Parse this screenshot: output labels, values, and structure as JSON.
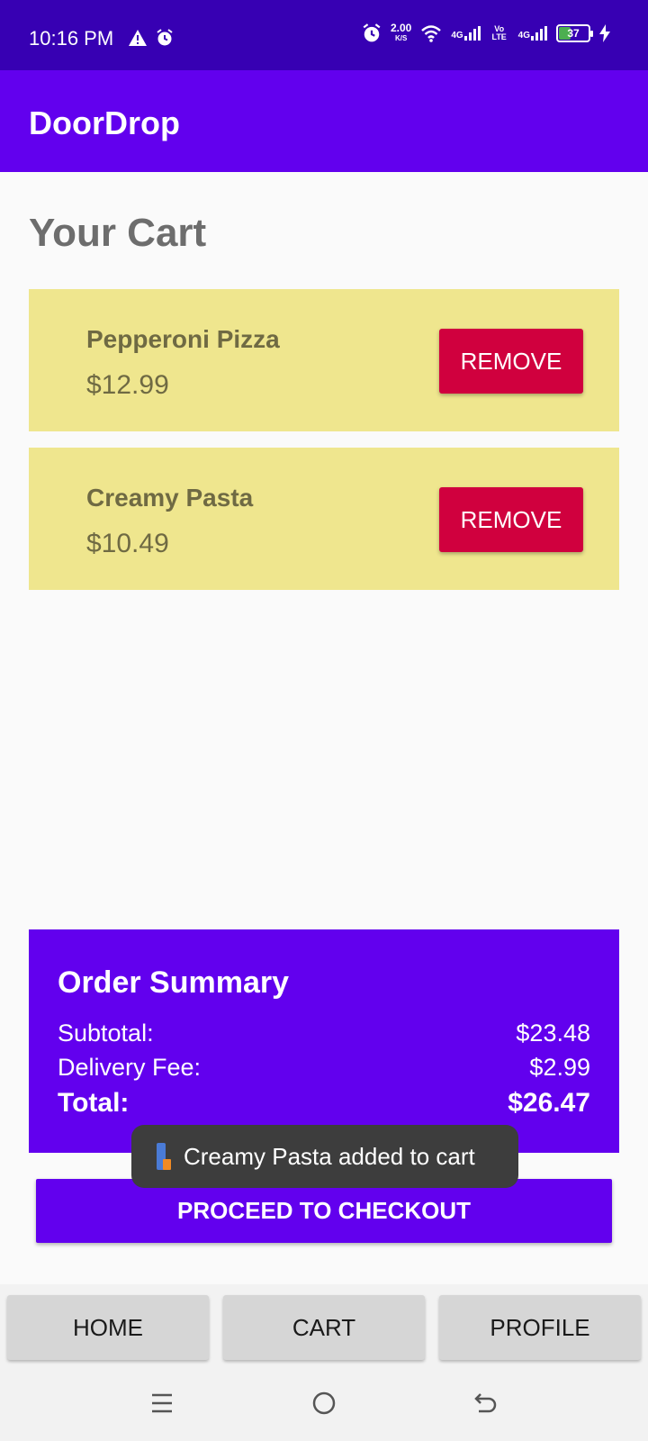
{
  "status_bar": {
    "time": "10:16 PM",
    "net_speed_value": "2.00",
    "net_speed_unit": "K/S",
    "sim1_label": "4G",
    "volte_label": "Vo LTE",
    "sim2_label": "4G",
    "battery_level": "37"
  },
  "app_bar": {
    "title": "DoorDrop"
  },
  "page": {
    "title": "Your Cart"
  },
  "cart_items": [
    {
      "name": "Pepperoni Pizza",
      "price": "$12.99",
      "remove_label": "REMOVE"
    },
    {
      "name": "Creamy Pasta",
      "price": "$10.49",
      "remove_label": "REMOVE"
    }
  ],
  "summary": {
    "title": "Order Summary",
    "subtotal_label": "Subtotal:",
    "subtotal_value": "$23.48",
    "delivery_label": "Delivery Fee:",
    "delivery_value": "$2.99",
    "total_label": "Total:",
    "total_value": "$26.47"
  },
  "toast": {
    "message": "Creamy Pasta added to cart"
  },
  "checkout": {
    "label": "PROCEED TO CHECKOUT"
  },
  "bottom_nav": [
    {
      "label": "HOME"
    },
    {
      "label": "CART"
    },
    {
      "label": "PROFILE"
    }
  ],
  "colors": {
    "status_bar": "#3700b3",
    "primary": "#6200ee",
    "item_card": "#efe68e",
    "remove": "#d0003e",
    "nav_button": "#d6d6d6"
  }
}
